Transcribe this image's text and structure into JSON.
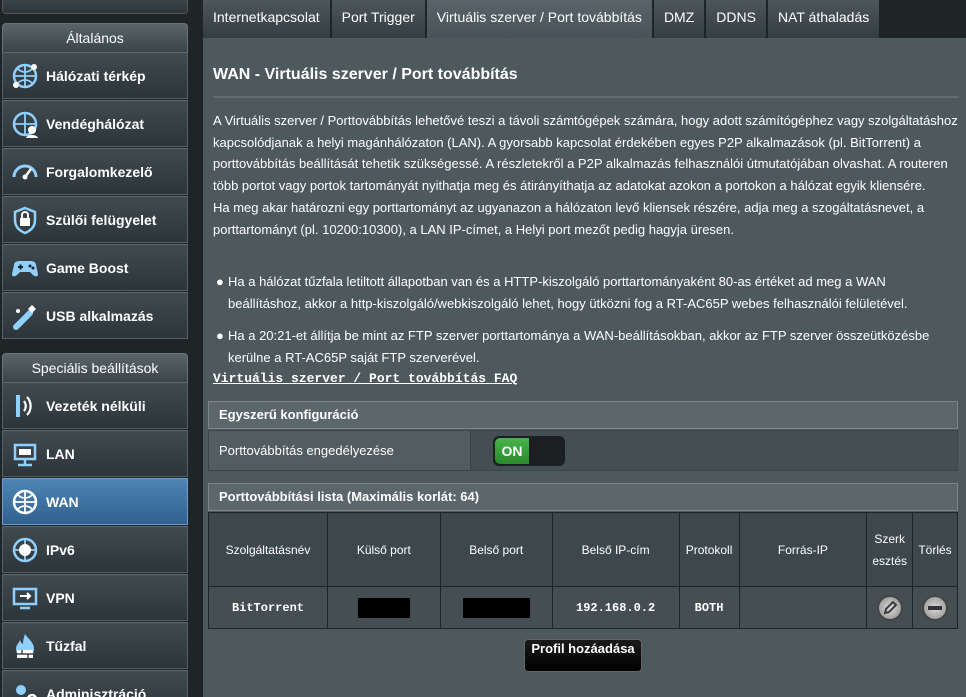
{
  "sidebar": {
    "general_header": "Általános",
    "advanced_header": "Speciális beállítások",
    "general_items": [
      {
        "label": "Hálózati térkép",
        "icon": "globe-network-icon"
      },
      {
        "label": "Vendéghálózat",
        "icon": "guest-network-icon"
      },
      {
        "label": "Forgalomkezelő",
        "icon": "traffic-manager-icon"
      },
      {
        "label": "Szülői felügyelet",
        "icon": "lock-shield-icon"
      },
      {
        "label": "Game Boost",
        "icon": "gamepad-icon"
      },
      {
        "label": "USB alkalmazás",
        "icon": "usb-icon"
      }
    ],
    "advanced_items": [
      {
        "label": "Vezeték nélküli",
        "icon": "wifi-icon"
      },
      {
        "label": "LAN",
        "icon": "lan-icon"
      },
      {
        "label": "WAN",
        "icon": "globe-icon",
        "active": true
      },
      {
        "label": "IPv6",
        "icon": "ipv6-icon"
      },
      {
        "label": "VPN",
        "icon": "vpn-icon"
      },
      {
        "label": "Tűzfal",
        "icon": "firewall-icon"
      },
      {
        "label": "Adminisztráció",
        "icon": "admin-icon"
      }
    ]
  },
  "tabs": [
    {
      "label": "Internetkapcsolat"
    },
    {
      "label": "Port Trigger"
    },
    {
      "label": "Virtuális szerver / Port továbbítás",
      "active": true
    },
    {
      "label": "DMZ"
    },
    {
      "label": "DDNS"
    },
    {
      "label": "NAT áthaladás"
    }
  ],
  "main": {
    "title": "WAN - Virtuális szerver / Port továbbítás",
    "description": "A Virtuális szerver / Porttovábbítás lehetővé teszi a távoli számtógépek számára, hogy adott számítógéphez vagy szolgáltatáshoz kapcsolódjanak a helyi magánhálózaton (LAN). A gyorsabb kapcsolat érdekében egyes P2P alkalmazások (pl. BitTorrent) a porttovábbítás beállítását tehetik szükségessé. A részletekről a P2P alkalmazás felhasználói útmutatójában olvashat. A routeren több portot vagy portok tartományát nyithatja meg és átirányíthatja az adatokat azokon a portokon a hálózat egyik kliensére.",
    "description2": "Ha meg akar határozni egy porttartományt az ugyanazon a hálózaton levő kliensek részére, adja meg a szogáltatásnevet, a porttartományt (pl. 10200:10300), a LAN IP-címet, a Helyi port mezőt pedig hagyja üresen.",
    "bullets": [
      "Ha a hálózat tűzfala letiltott állapotban van és a HTTP-kiszolgáló porttartományaként 80-as értéket ad meg a WAN beállításhoz, akkor a http-kiszolgáló/webkiszolgáló lehet, hogy ütközni fog a RT-AC65P webes felhasználói felületével.",
      "Ha a 20:21-et állítja be mint az FTP szerver porttartománya a WAN-beállításokban, akkor az FTP szerver összeütközésbe kerülne a RT-AC65P saját FTP szerverével."
    ],
    "faq_link": "Virtuális szerver / Port továbbítás FAQ",
    "basic_config": {
      "header": "Egyszerű konfiguráció",
      "enable_label": "Porttovábbítás engedélyezése",
      "toggle_state": "ON",
      "toggle_color": "#3aa33d"
    },
    "list": {
      "header": "Porttovábbítási lista (Maximális korlát: 64)",
      "columns": [
        "Szolgáltatásnév",
        "Külső port",
        "Belső port",
        "Belső IP-cím",
        "Protokoll",
        "Forrás-IP",
        "Szerk esztés",
        "Törlés"
      ],
      "rows": [
        {
          "service": "BitTorrent",
          "external_port": "",
          "internal_port": "",
          "ip": "192.168.0.2",
          "protocol": "BOTH",
          "source_ip": ""
        }
      ]
    },
    "add_profile_button": "Profil hozáadása"
  },
  "colors": {
    "background": "#1f2427",
    "panel": "#4d595d",
    "active_menu": "#4279ab"
  }
}
